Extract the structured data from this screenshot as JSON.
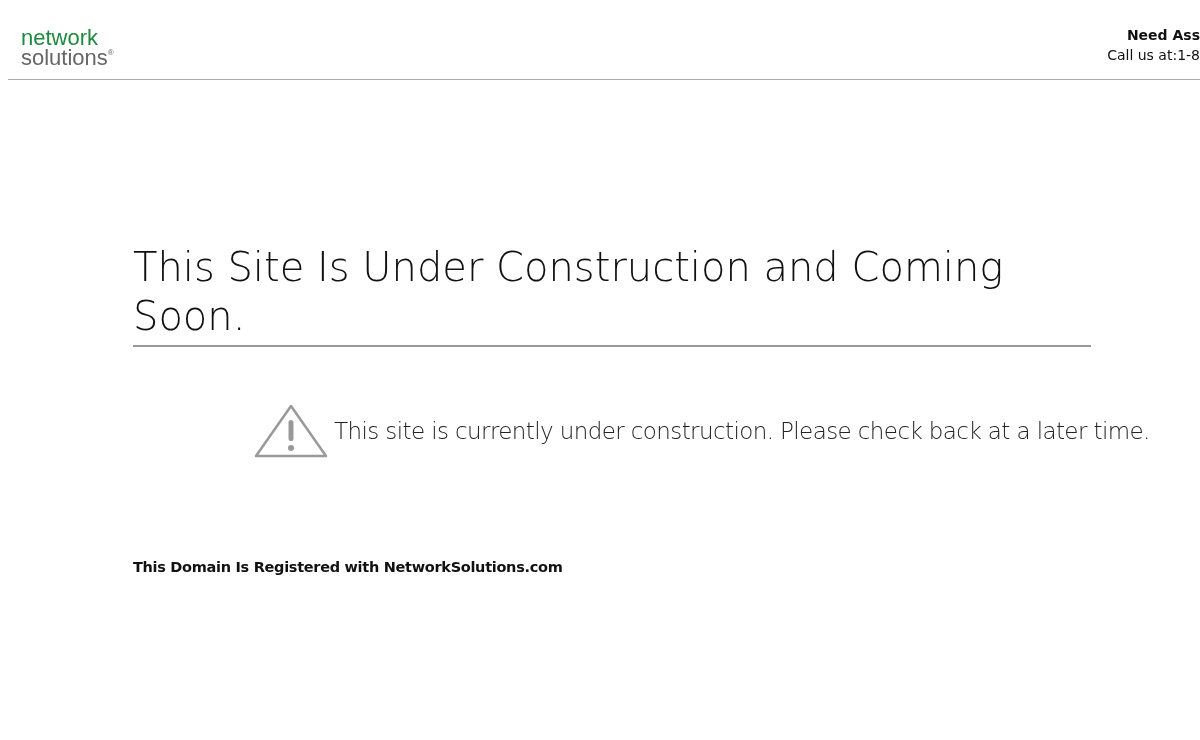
{
  "header": {
    "logo": {
      "line_1": "network",
      "line_2": "solutions",
      "mark": "®"
    },
    "help": {
      "title": "Need Ass",
      "phone": "Call us at:1-8"
    }
  },
  "heading": "This Site Is Under Construction and Coming Soon.",
  "notice": "This site is currently under construction. Please check back at a later time.",
  "footer_note": "This Domain Is Registered with NetworkSolutions.com"
}
